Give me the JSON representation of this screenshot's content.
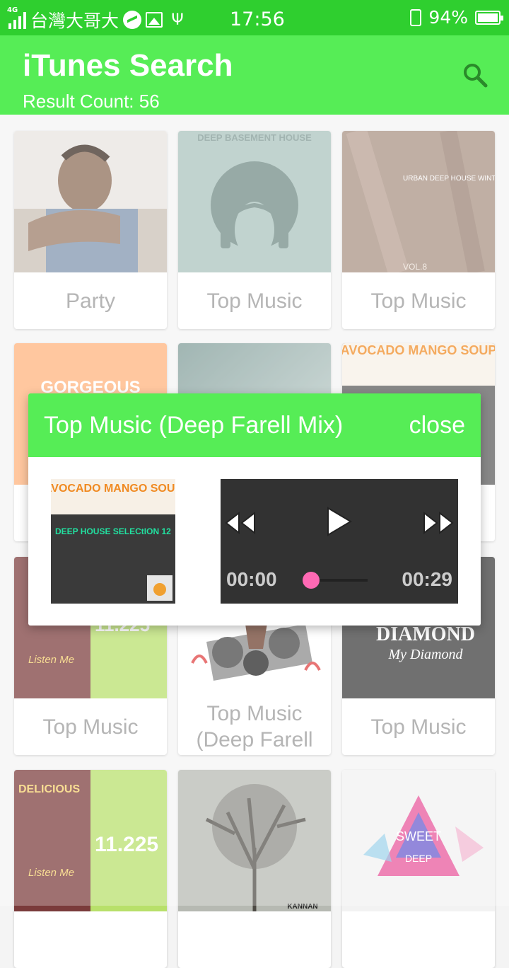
{
  "status_bar": {
    "network": "4G",
    "carrier": "台灣大哥大",
    "time": "17:56",
    "battery": "94%"
  },
  "app_bar": {
    "title": "iTunes Search",
    "subtitle": "Result Count: 56",
    "search_icon": "search-icon"
  },
  "grid": [
    {
      "label": "Party"
    },
    {
      "label": "Top Music",
      "art_text": "DEEP BASEMENT HOUSE"
    },
    {
      "label": "Top Music",
      "art_text": "URBAN DEEP HOUSE WINTER SEASON",
      "art_text2": "VOL.8"
    },
    {
      "label": "",
      "art_text": "GORGEOUS"
    },
    {
      "label": ""
    },
    {
      "label": "",
      "art_text": "AVOCADO MANGO SOUP"
    },
    {
      "label": "Top Music",
      "art_text": "Listen Me",
      "art_text2": "11.225"
    },
    {
      "label": "Top Music (Deep Farell"
    },
    {
      "label": "Top Music",
      "art_text": "DIAMOND",
      "art_text2": "My Diamond"
    },
    {
      "label": "",
      "art_text": "DELICIOUS",
      "art_text2": "11.225",
      "art_text3": "Listen Me"
    },
    {
      "label": "",
      "art_text": "KANNAN"
    },
    {
      "label": "",
      "art_text": "SWEET",
      "art_text2": "DEEP"
    }
  ],
  "dialog": {
    "title": "Top Music (Deep Farell Mix)",
    "close_label": "close",
    "art_text": "AVOCADO MANGO SOUP",
    "art_text2": "DEEP HOUSE SELECtION 12",
    "player": {
      "current_time": "00:00",
      "duration": "00:29",
      "progress": 0.0
    }
  }
}
